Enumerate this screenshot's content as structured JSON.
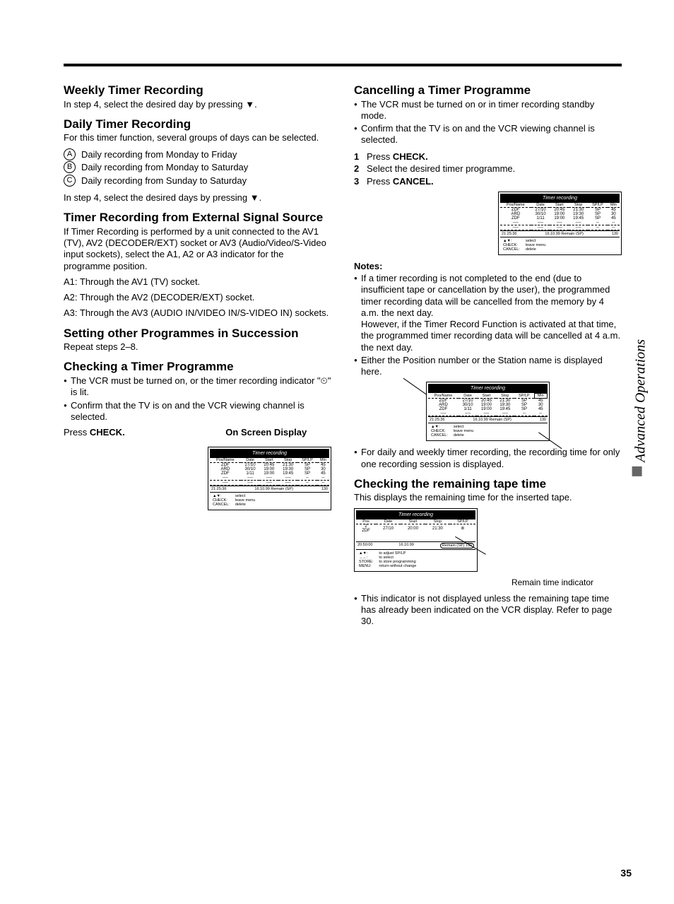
{
  "page_number": "35",
  "side_tab": "Advanced Operations",
  "left": {
    "weekly": {
      "heading": "Weekly Timer Recording",
      "body": "In step 4, select the desired day by pressing ▼."
    },
    "daily": {
      "heading": "Daily Timer Recording",
      "intro": "For this timer function, several groups of days can be selected.",
      "opts": {
        "a": "Daily recording from Monday to Friday",
        "b": "Daily recording from Monday to Saturday",
        "c": "Daily recording from Sunday to Saturday"
      },
      "tail": "In step 4, select the desired days by pressing ▼."
    },
    "external": {
      "heading": "Timer Recording from External Signal Source",
      "body": "If Timer Recording is performed by a unit connected to the AV1 (TV), AV2 (DECODER/EXT) socket or AV3 (Audio/Video/S-Video input sockets), select the A1, A2 or A3 indicator for the programme position.",
      "a1": "A1: Through the AV1 (TV) socket.",
      "a2": "A2: Through the AV2 (DECODER/EXT) socket.",
      "a3": "A3: Through the AV3 (AUDIO IN/VIDEO IN/S-VIDEO IN) sockets."
    },
    "succession": {
      "heading": "Setting other Programmes in Succession",
      "body": "Repeat steps 2–8."
    },
    "checking": {
      "heading": "Checking a Timer Programme",
      "b1": "The VCR must be turned on, or the timer recording indicator \"⏲\" is lit.",
      "b2": "Confirm that the TV is on and the VCR viewing channel is selected.",
      "press": "Press",
      "check": " CHECK.",
      "osd_label": "On Screen Display"
    }
  },
  "right": {
    "cancel": {
      "heading": "Cancelling a Timer Programme",
      "b1": "The VCR must be turned on or in timer recording standby mode.",
      "b2": "Confirm that the TV is on and the VCR viewing channel is selected.",
      "s1": "Press ",
      "s1b": "CHECK.",
      "s2": "Select the desired timer programme.",
      "s3": "Press ",
      "s3b": "CANCEL."
    },
    "notes": {
      "heading": "Notes:",
      "n1": "If a timer recording is not completed to the end (due to insufficient tape or cancellation by the user), the programmed timer recording data will be cancelled from the memory by 4 a.m. the next day.\nHowever, if the Timer Record Function is activated at that time, the programmed timer recording data will be cancelled at 4 a.m. the next day.",
      "n2": "Either the Position number or the Station name is displayed here.",
      "n3": "For daily and weekly timer recording, the recording time for only one recording session is displayed."
    },
    "tape": {
      "heading": "Checking the remaining tape time",
      "intro": "This displays the remaining time for the inserted tape.",
      "caption": "Remain time indicator",
      "b1": "This indicator is not displayed unless the remaining tape time has already been indicated on the VCR display. Refer to page 30."
    }
  },
  "osd_common": {
    "title": "Timer recording",
    "cols": [
      "Pos/Name",
      "Date",
      "Start",
      "Stop",
      "SP/LP",
      "Min"
    ],
    "rows": [
      [
        "ZDF",
        "27/10",
        "20:45",
        "21:30",
        "SP",
        "45"
      ],
      [
        "ARD",
        "30/10",
        "19:00",
        "19:30",
        "SP",
        "30"
      ],
      [
        "ZDF",
        "1/11",
        "19:00",
        "19:45",
        "SP",
        "45"
      ]
    ],
    "footer_left": "21:25:36",
    "footer_mid": "16.10.99  Remain (SP)",
    "footer_right": "130",
    "menu_left": "▲▼:\nCHECK:\nCANCEL:",
    "menu_right": "select\nleave menu\ndelete"
  },
  "osd_tape": {
    "title": "Timer recording",
    "cols": [
      "Pos",
      "Date",
      "Start",
      "Stop",
      "SP/LP"
    ],
    "row": [
      "2\nZDF",
      "27/10",
      "20:00",
      "21:30",
      "⊛"
    ],
    "footer_left": "20:50:00",
    "footer_mid": "16.10.99",
    "footer_remain": "Remain (SP)   130",
    "menu_left": "▲▼:\n→←:\nSTORE:\nMENU:",
    "menu_right": "to adjust SP/LP\nto select\nto store programming\nreturn without change"
  }
}
